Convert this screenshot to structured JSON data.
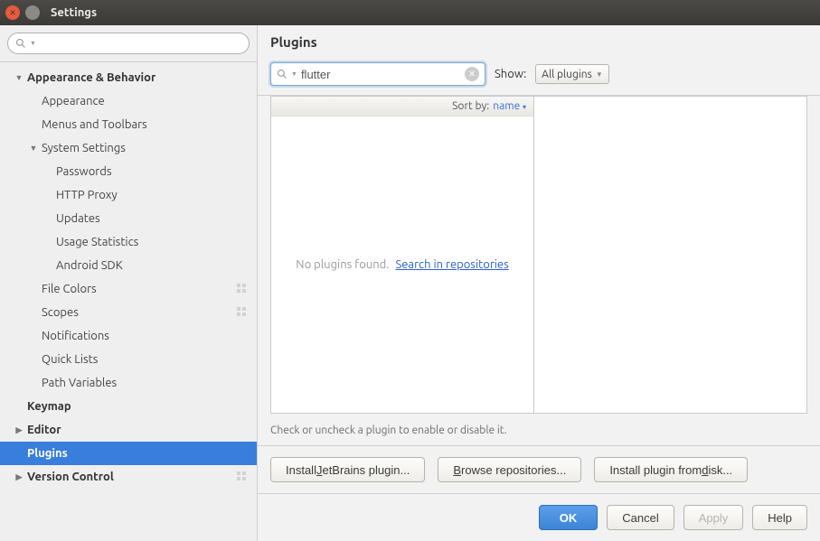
{
  "window": {
    "title": "Settings"
  },
  "sidebar": {
    "search_placeholder": "",
    "items": [
      {
        "label": "Appearance & Behavior",
        "depth": 0,
        "bold": true,
        "arrow": "▼"
      },
      {
        "label": "Appearance",
        "depth": 1
      },
      {
        "label": "Menus and Toolbars",
        "depth": 1
      },
      {
        "label": "System Settings",
        "depth": 1,
        "arrow": "▼"
      },
      {
        "label": "Passwords",
        "depth": 2
      },
      {
        "label": "HTTP Proxy",
        "depth": 2
      },
      {
        "label": "Updates",
        "depth": 2
      },
      {
        "label": "Usage Statistics",
        "depth": 2
      },
      {
        "label": "Android SDK",
        "depth": 2
      },
      {
        "label": "File Colors",
        "depth": 1,
        "proj": true
      },
      {
        "label": "Scopes",
        "depth": 1,
        "proj": true
      },
      {
        "label": "Notifications",
        "depth": 1
      },
      {
        "label": "Quick Lists",
        "depth": 1
      },
      {
        "label": "Path Variables",
        "depth": 1
      },
      {
        "label": "Keymap",
        "depth": 0,
        "bold": true
      },
      {
        "label": "Editor",
        "depth": 0,
        "bold": true,
        "arrow": "▶"
      },
      {
        "label": "Plugins",
        "depth": 0,
        "bold": true,
        "selected": true
      },
      {
        "label": "Version Control",
        "depth": 0,
        "bold": true,
        "arrow": "▶",
        "proj": true
      }
    ]
  },
  "main": {
    "title": "Plugins",
    "filter_value": "flutter",
    "show_label": "Show:",
    "show_combo": "All plugins",
    "sort_label": "Sort by:",
    "sort_value": "name",
    "empty_text": "No plugins found.",
    "empty_link": "Search in repositories",
    "hint": "Check or uncheck a plugin to enable or disable it.",
    "btn_jetbrains": "Install JetBrains plugin...",
    "btn_browse": "Browse repositories...",
    "btn_disk": "Install plugin from disk..."
  },
  "footer": {
    "ok": "OK",
    "cancel": "Cancel",
    "apply": "Apply",
    "help": "Help"
  }
}
